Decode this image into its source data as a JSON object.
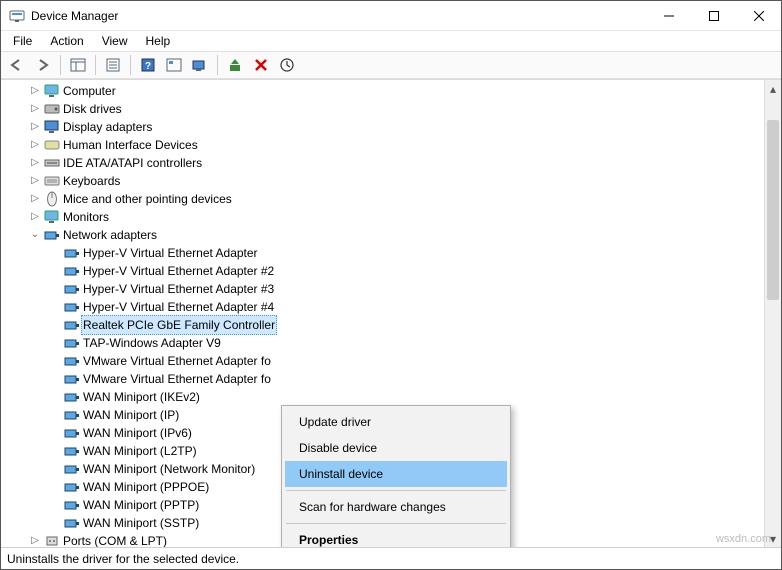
{
  "window": {
    "title": "Device Manager"
  },
  "menu": {
    "file": "File",
    "action": "Action",
    "view": "View",
    "help": "Help"
  },
  "categories": [
    {
      "label": "Computer",
      "icon": "monitor"
    },
    {
      "label": "Disk drives",
      "icon": "disk"
    },
    {
      "label": "Display adapters",
      "icon": "display"
    },
    {
      "label": "Human Interface Devices",
      "icon": "hid"
    },
    {
      "label": "IDE ATA/ATAPI controllers",
      "icon": "ide"
    },
    {
      "label": "Keyboards",
      "icon": "keyboard"
    },
    {
      "label": "Mice and other pointing devices",
      "icon": "mouse"
    },
    {
      "label": "Monitors",
      "icon": "monitor"
    }
  ],
  "network": {
    "label": "Network adapters",
    "items": [
      "Hyper-V Virtual Ethernet Adapter",
      "Hyper-V Virtual Ethernet Adapter #2",
      "Hyper-V Virtual Ethernet Adapter #3",
      "Hyper-V Virtual Ethernet Adapter #4",
      "Realtek PCIe GbE Family Controller",
      "TAP-Windows Adapter V9",
      "VMware Virtual Ethernet Adapter fo",
      "VMware Virtual Ethernet Adapter fo",
      "WAN Miniport (IKEv2)",
      "WAN Miniport (IP)",
      "WAN Miniport (IPv6)",
      "WAN Miniport (L2TP)",
      "WAN Miniport (Network Monitor)",
      "WAN Miniport (PPPOE)",
      "WAN Miniport (PPTP)",
      "WAN Miniport (SSTP)"
    ],
    "selected_index": 4
  },
  "after": [
    {
      "label": "Ports (COM & LPT)",
      "icon": "port"
    }
  ],
  "context_menu": {
    "update": "Update driver",
    "disable": "Disable device",
    "uninstall": "Uninstall device",
    "scan": "Scan for hardware changes",
    "properties": "Properties"
  },
  "status": "Uninstalls the driver for the selected device.",
  "watermark": "wsxdn.com"
}
